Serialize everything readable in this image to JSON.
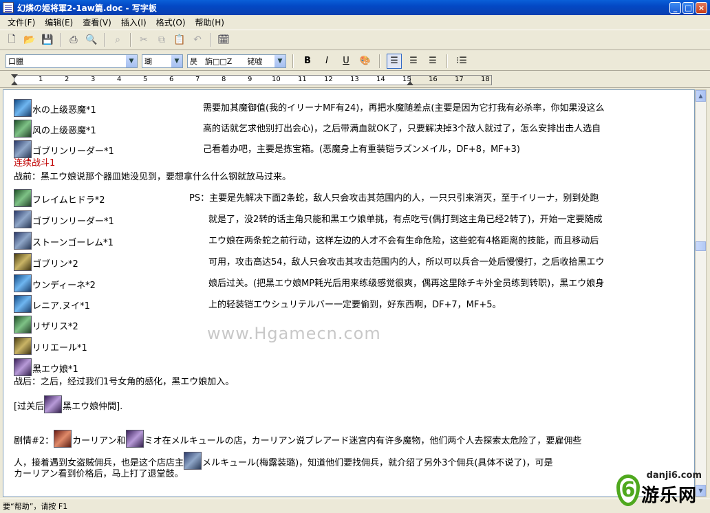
{
  "window": {
    "title": "幻燐の姫将軍2-1aw篇.doc - 写字板",
    "minimize": "_",
    "maximize": "□",
    "close": "×"
  },
  "menu": [
    "文件(F)",
    "编辑(E)",
    "查看(V)",
    "插入(I)",
    "格式(O)",
    "帮助(H)"
  ],
  "format_bar": {
    "font": "口臘",
    "size": "瑚",
    "script": "昃　旃□□Z　　铑嘘",
    "bold": "B",
    "italic": "I",
    "underline": "U"
  },
  "ruler": {
    "ticks": [
      "1",
      "2",
      "3",
      "4",
      "5",
      "6",
      "7",
      "8",
      "9",
      "10",
      "11",
      "12",
      "13",
      "14",
      "15",
      "16",
      "17",
      "18"
    ]
  },
  "document": {
    "left": [
      "水の上级恶魔*1",
      "风の上级恶魔*1",
      "ゴブリンリーダー*1",
      "连续战斗1",
      "战前：黑エウ娘说那个器皿她没见到，要想拿什么什么钢就放马过来。",
      "フレイムヒドラ*2",
      "ゴブリンリーダー*1",
      "ストーンゴーレム*1",
      "ゴブリン*2",
      "ウンディーネ*2",
      "レニア.ヌイ*1",
      "リザリス*2",
      "リリエール*1",
      "黑エウ娘*1",
      "战后：之后，经过我们1号女角的感化，黑エウ娘加入。"
    ],
    "block1": [
      "需要加其魔御值(我的イリーナMF有24)，再把水魔随差点(主要是因为它打我有必杀率，你如果没这么",
      "高的话就乞求他别打出会心)，之后带满血就OK了，只要解决掉3个敌人就过了，怎么安排出击人选自",
      "己看着办吧，主要是拣宝箱。(恶魔身上有重装铠ラズンメイル，DF+8，MF+3)"
    ],
    "ps_label": "PS：",
    "block2": [
      "主要是先解决下面2条蛇，敌人只会攻击其范围内的人，一只只引来消灭，至于イリーナ，别到处跑",
      "就是了，没2转的话主角只能和黑エウ娘单挑，有点吃亏(偶打到这主角已经2转了)，开始一定要随成",
      "エウ娘在两条蛇之前行动，这样左边的人才不会有生命危险，这些蛇有4格距离的技能，而且移动后",
      "可用，攻击高达54，敌人只会攻击其攻击范围内的人，所以可以兵合一处后慢慢打，之后收拾黑エウ",
      "娘后过关。(把黑エウ娘MP耗光后用来练级感觉很爽，偶再这里除チキ外全员练到转职)，黑エウ娘身",
      "上的轻装铠エウシュリテルバー一定要偷到，好东西啊，DF+7，MF+5。"
    ],
    "after_clear_pre": "[过关后",
    "after_clear_post": "黑エウ娘仲間].",
    "story_label": "剧情#2：",
    "story_name1": "カーリアン和",
    "story_line1_rest": "ミオ在メルキュールの店，カーリアン说ブレアード迷宫内有许多魔物，他们两个人去探索太危险了，要雇佣些",
    "story_line2_pre": "人，接着遇到女盗贼佣兵，也是这个店店主",
    "story_line2_post": "メルキュール(梅露装璐)，知道他们要找佣兵，就介绍了另外3个佣兵(具体不说了)，可是",
    "story_line3": "カーリアン看到价格后，马上打了退堂鼓。",
    "watermark": "www.Hgamecn.com"
  },
  "status": "要“帮助”，请按 F1",
  "logo": {
    "url": "danji6.com",
    "six": "6",
    "name": "游乐网"
  }
}
